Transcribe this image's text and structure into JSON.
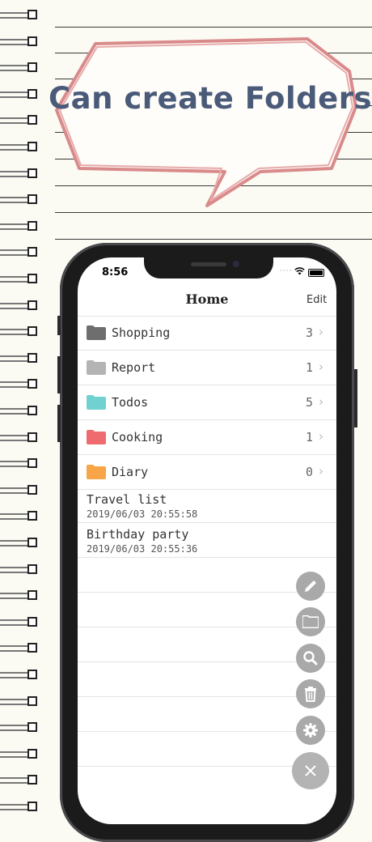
{
  "banner": {
    "title": "Can create Folders"
  },
  "status_bar": {
    "time": "8:56",
    "signal": "····"
  },
  "nav": {
    "title": "Home",
    "edit_label": "Edit"
  },
  "folders": [
    {
      "label": "Shopping",
      "count": "3",
      "color": "#6e6e6e"
    },
    {
      "label": "Report",
      "count": "1",
      "color": "#b4b4b4"
    },
    {
      "label": "Todos",
      "count": "5",
      "color": "#6fd2d0"
    },
    {
      "label": "Cooking",
      "count": "1",
      "color": "#f06b6f"
    },
    {
      "label": "Diary",
      "count": "0",
      "color": "#f7a546"
    }
  ],
  "chevron": "›",
  "notes": [
    {
      "title": "Travel list",
      "date": "2019/06/03 20:55:58"
    },
    {
      "title": "Birthday party",
      "date": "2019/06/03 20:55:36"
    }
  ],
  "fab_actions": [
    {
      "name": "compose",
      "icon": "pencil-icon"
    },
    {
      "name": "new-folder",
      "icon": "folder-icon"
    },
    {
      "name": "search",
      "icon": "search-icon"
    },
    {
      "name": "delete",
      "icon": "trash-icon"
    },
    {
      "name": "settings",
      "icon": "gear-icon"
    },
    {
      "name": "close",
      "icon": "close-icon"
    }
  ],
  "colors": {
    "banner_text": "#4a5b7a",
    "bubble_outline": "#d98a8a",
    "fab": "#a9a9a9",
    "paper": "#fbfaf3"
  }
}
